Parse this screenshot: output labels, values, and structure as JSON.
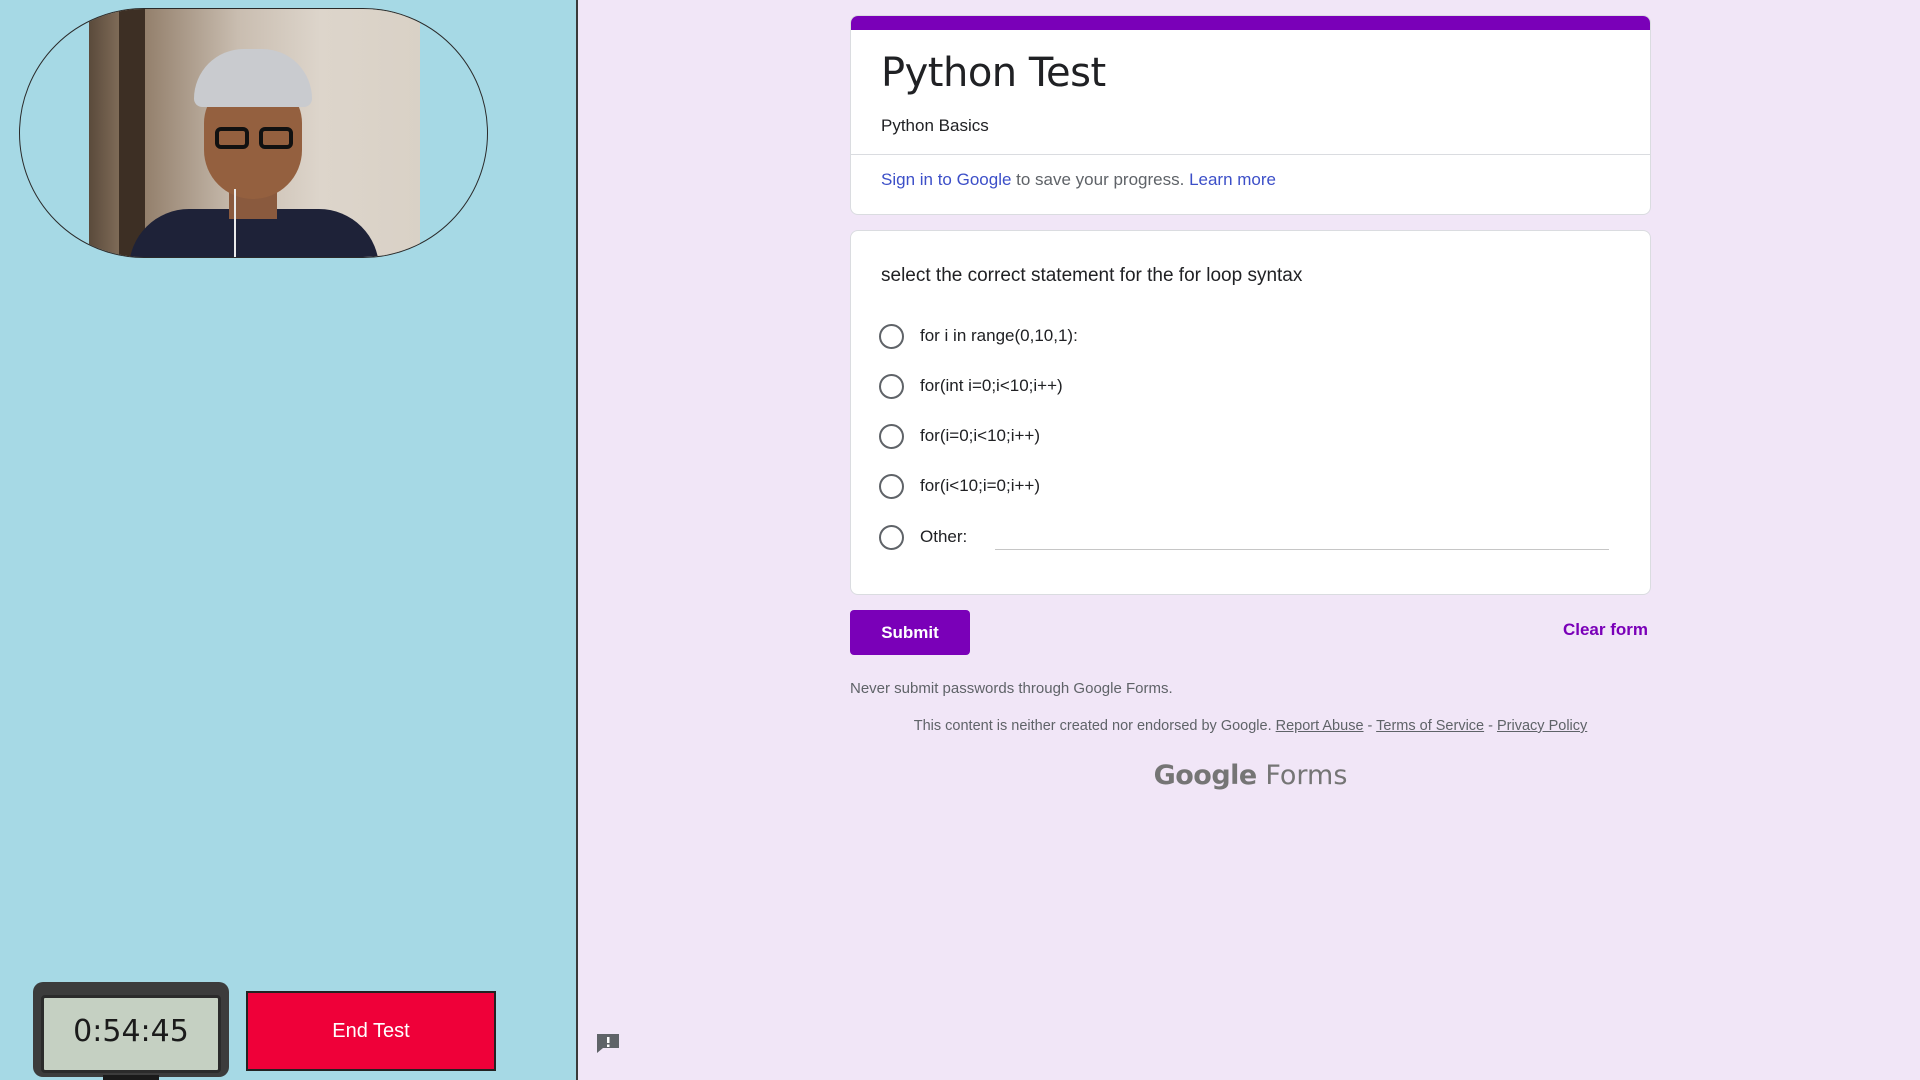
{
  "proctor": {
    "timer_value": "0:54:45",
    "end_test_label": "End Test"
  },
  "form": {
    "title": "Python Test",
    "subtitle": "Python Basics",
    "signin": {
      "link_text": "Sign in to Google",
      "middle_text": " to save your progress. ",
      "learn_more": "Learn more"
    },
    "question": {
      "text": "select the correct statement for the for loop syntax",
      "options": [
        "for i in range(0,10,1):",
        "for(int i=0;i<10;i++)",
        "for(i=0;i<10;i++)",
        "for(i<10;i=0;i++)",
        "Other:"
      ]
    },
    "submit_label": "Submit",
    "clear_label": "Clear form",
    "password_warning": "Never submit passwords through Google Forms.",
    "footer": {
      "disclaimer": "This content is neither created nor endorsed by Google. ",
      "report_abuse": "Report Abuse",
      "sep": " - ",
      "terms": "Terms of Service",
      "privacy": "Privacy Policy"
    },
    "logo": {
      "google": "Google",
      "forms": "Forms"
    }
  },
  "colors": {
    "accent": "#7a00b8",
    "end_test_bg": "#ef0039",
    "left_panel_bg": "#a6d9e5",
    "form_bg": "#f1e6f7"
  },
  "icons": {
    "report": "report-problem-icon"
  }
}
